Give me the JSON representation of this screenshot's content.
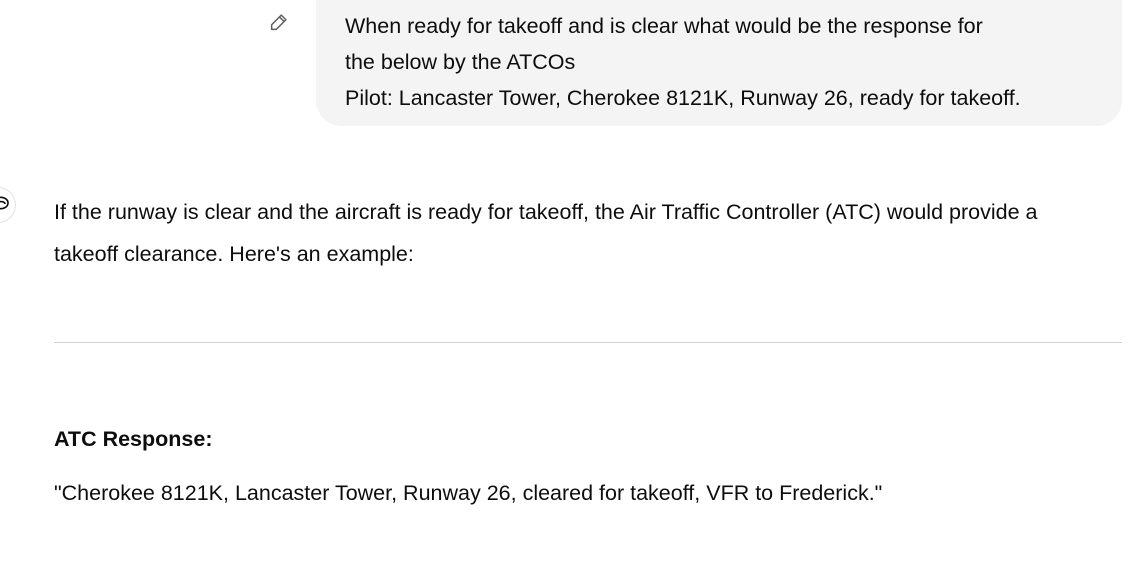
{
  "user_message": {
    "edit_icon": "pencil-icon",
    "lines": [
      "When ready for takeoff and is clear what would be the response for",
      "the below by the ATCOs",
      "Pilot: Lancaster Tower, Cherokee 8121K, Runway 26, ready for takeoff."
    ]
  },
  "assistant_message": {
    "avatar_icon": "assistant-logo-icon",
    "intro": "If the runway is clear and the aircraft is ready for takeoff, the Air Traffic Controller (ATC) would provide a takeoff clearance. Here's an example:",
    "response_label": "ATC Response:",
    "response_text": "\"Cherokee 8121K, Lancaster Tower, Runway 26, cleared for takeoff, VFR to Frederick.\""
  }
}
